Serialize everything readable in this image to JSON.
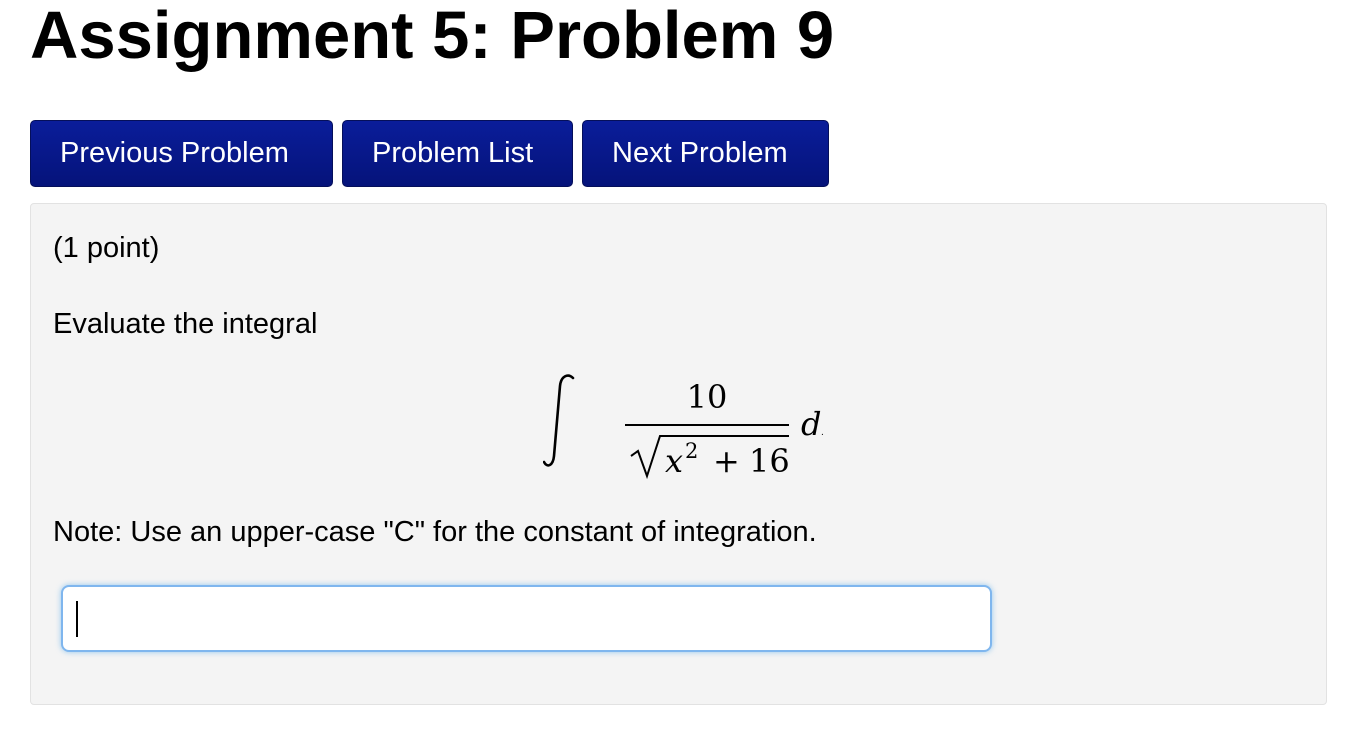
{
  "header": {
    "title": "Assignment 5: Problem 9"
  },
  "nav": {
    "previous_label": "Previous Problem",
    "list_label": "Problem List",
    "next_label": "Next Problem"
  },
  "problem": {
    "points": "(1 point)",
    "prompt": "Evaluate the integral",
    "integral": {
      "numerator": "10",
      "radicand_var": "x",
      "exponent": "2",
      "plus": "+",
      "constant": "16",
      "differential": "dx"
    },
    "note": "Note: Use an upper-case \"C\" for the constant of integration.",
    "answer_value": ""
  },
  "icons": {
    "integral_sign": "integral-sign-icon",
    "square_root": "square-root-icon"
  },
  "colors": {
    "button_bg": "#0a1d9a",
    "button_text": "#ffffff",
    "panel_bg": "#f4f4f4",
    "input_focus_border": "#7fb6ee"
  }
}
